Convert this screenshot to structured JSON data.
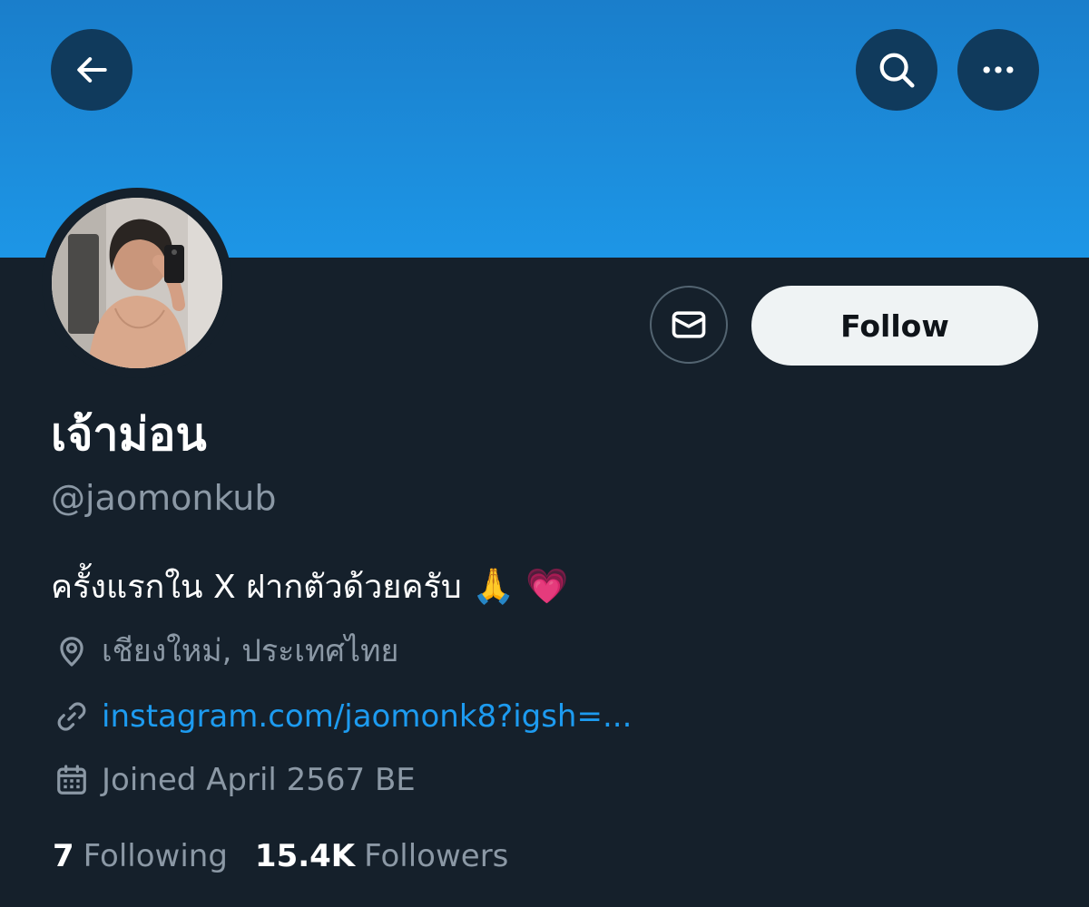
{
  "profile": {
    "display_name": "เจ้าม่อน",
    "handle": "@jaomonkub",
    "bio_text": "ครั้งแรกใน X ฝากตัวด้วยครับ",
    "bio_emoji_1": "🙏",
    "bio_emoji_2": "💗",
    "location": "เชียงใหม่, ประเทศไทย",
    "link": "instagram.com/jaomonk8?igsh=...",
    "joined": "Joined April 2567 BE"
  },
  "actions": {
    "follow_label": "Follow"
  },
  "stats": {
    "following_count": "7",
    "following_label": "Following",
    "followers_count": "15.4K",
    "followers_label": "Followers"
  },
  "icons": {
    "back": "arrow-left-icon",
    "search": "search-icon",
    "more": "more-horizontal-icon",
    "message": "envelope-icon",
    "location": "location-pin-icon",
    "link": "link-icon",
    "calendar": "calendar-icon"
  },
  "colors": {
    "background": "#15202b",
    "banner_top": "#1a7ecb",
    "banner_bottom": "#1d96e6",
    "link": "#1d9bf0",
    "secondary_text": "#8b98a5",
    "follow_button_bg": "#eff3f4"
  }
}
